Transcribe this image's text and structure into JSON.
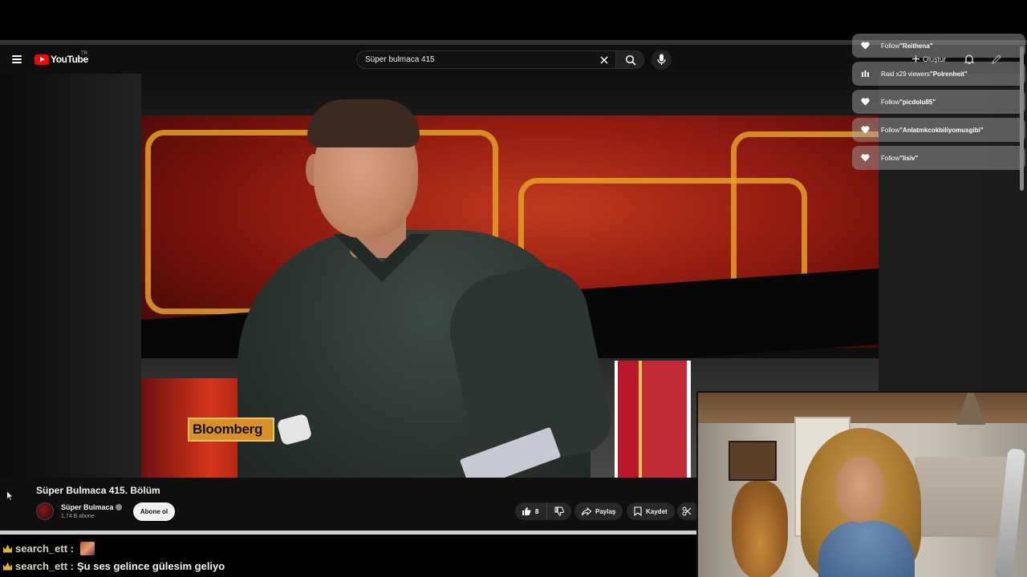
{
  "masthead": {
    "logo_text": "YouTube",
    "country_code": "TR",
    "search_value": "Süper bulmaca 415",
    "create_label": "Oluştur"
  },
  "video": {
    "title": "Süper Bulmaca 415. Bölüm",
    "overlay_brand": "Bloomberg"
  },
  "channel": {
    "name": "Süper Bulmaca",
    "subscribers": "1,74 B abone",
    "subscribe_label": "Abone ol"
  },
  "actions": {
    "like_count": "8",
    "share_label": "Paylaş",
    "save_label": "Kaydet"
  },
  "chat": [
    {
      "user": "search_ett :",
      "message": ""
    },
    {
      "user": "search_ett :",
      "message": "Şu ses gelince gülesim geliyo"
    }
  ],
  "alerts": [
    {
      "icon": "heart-icon",
      "prefix": "Follow ",
      "name": "\"Reithena\""
    },
    {
      "icon": "raid-icon",
      "prefix": "Raid x29 viewers ",
      "name": "\"Polrenheit\""
    },
    {
      "icon": "heart-icon",
      "prefix": "Follow ",
      "name": "\"picdolu85\""
    },
    {
      "icon": "heart-icon",
      "prefix": "Follow ",
      "name": "\"Anlatmkcokbiliyomusgibi\""
    },
    {
      "icon": "heart-icon",
      "prefix": "Follow ",
      "name": "\"lisiv\""
    }
  ],
  "colors": {
    "youtube_red": "#ff0000",
    "background": "#0f0f0f",
    "chat_crown": "#e8b21a"
  }
}
